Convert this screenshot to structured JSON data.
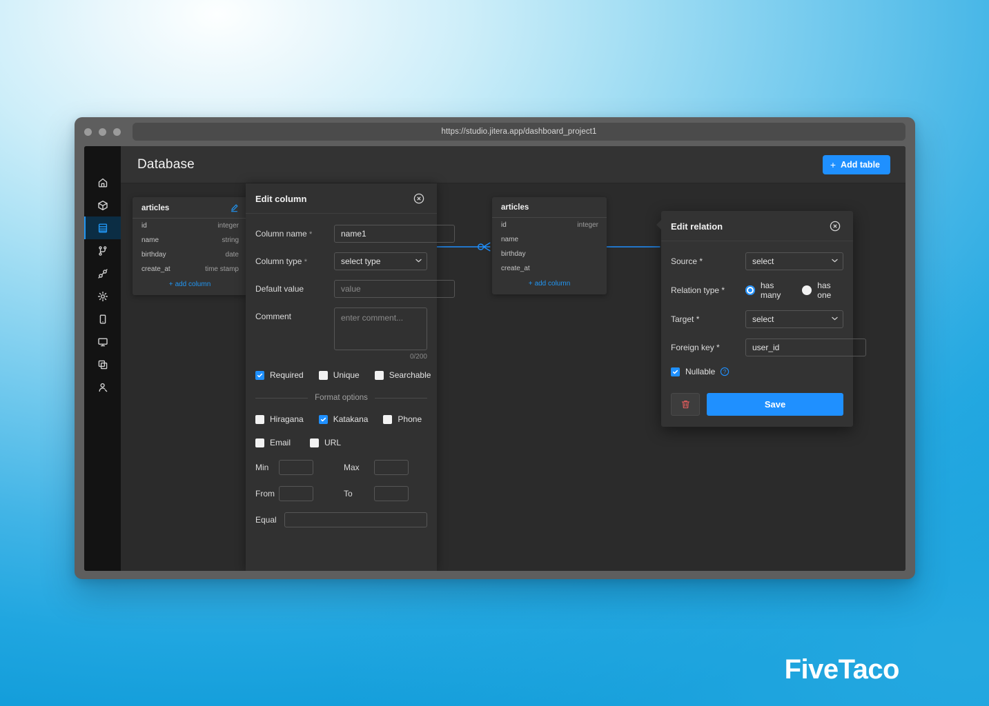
{
  "browser": {
    "url": "https://studio.jitera.app/dashboard_project1",
    "traffic_lights": [
      "close-dot",
      "minimize-dot",
      "maximize-dot"
    ]
  },
  "sidebar": {
    "items": [
      {
        "name": "home",
        "icon": "home-icon",
        "active": false
      },
      {
        "name": "package",
        "icon": "cube-icon",
        "active": false
      },
      {
        "name": "database",
        "icon": "database-icon",
        "active": true
      },
      {
        "name": "workflow",
        "icon": "branch-icon",
        "active": false
      },
      {
        "name": "plugins",
        "icon": "plug-icon",
        "active": false
      },
      {
        "name": "settings",
        "icon": "gear-icon",
        "active": false
      },
      {
        "name": "mobile",
        "icon": "mobile-icon",
        "active": false
      },
      {
        "name": "desktop",
        "icon": "monitor-icon",
        "active": false
      },
      {
        "name": "layers",
        "icon": "copy-icon",
        "active": false
      },
      {
        "name": "members",
        "icon": "user-search-icon",
        "active": false
      }
    ]
  },
  "header": {
    "title": "Database",
    "add_table_label": "Add table",
    "add_table_plus": "+"
  },
  "tables": [
    {
      "name": "articles",
      "edit_icon": "pencil-icon",
      "columns": [
        {
          "name": "id",
          "type": "integer"
        },
        {
          "name": "name",
          "type": "string"
        },
        {
          "name": "birthday",
          "type": "date"
        },
        {
          "name": "create_at",
          "type": "time stamp"
        }
      ],
      "add_column_label": "add column",
      "add_column_plus": "+"
    },
    {
      "name": "articles",
      "edit_icon": "pencil-icon",
      "columns": [
        {
          "name": "id",
          "type": "integer"
        },
        {
          "name": "name",
          "type": ""
        },
        {
          "name": "birthday",
          "type": ""
        },
        {
          "name": "create_at",
          "type": ""
        }
      ],
      "add_column_label": "add column",
      "add_column_plus": "+"
    }
  ],
  "edit_column": {
    "title": "Edit column",
    "close_icon": "close-circle-icon",
    "fields": {
      "column_name": {
        "label": "Column name",
        "required_mark": "*",
        "value": "name1"
      },
      "column_type": {
        "label": "Column type",
        "required_mark": "*",
        "value": "select type"
      },
      "default_value": {
        "label": "Default value",
        "placeholder": "value",
        "value": ""
      },
      "comment": {
        "label": "Comment",
        "placeholder": "enter comment...",
        "value": "",
        "counter": "0/200"
      }
    },
    "flags": [
      {
        "label": "Required",
        "checked": true
      },
      {
        "label": "Unique",
        "checked": false
      },
      {
        "label": "Searchable",
        "checked": false
      }
    ],
    "format_options_label": "Format options",
    "format_options": [
      {
        "label": "Hiragana",
        "checked": false
      },
      {
        "label": "Katakana",
        "checked": true
      },
      {
        "label": "Phone",
        "checked": false
      },
      {
        "label": "Email",
        "checked": false
      },
      {
        "label": "URL",
        "checked": false
      }
    ],
    "ranges": {
      "min_label": "Min",
      "min_value": "",
      "max_label": "Max",
      "max_value": "",
      "from_label": "From",
      "from_value": "",
      "to_label": "To",
      "to_value": "",
      "equal_label": "Equal",
      "equal_value": ""
    }
  },
  "edit_relation": {
    "title": "Edit relation",
    "close_icon": "close-circle-icon",
    "source": {
      "label": "Source",
      "required_mark": "*",
      "value": "select"
    },
    "relation_type": {
      "label": "Relation type",
      "required_mark": "*",
      "options": [
        {
          "label": "has many",
          "selected": true
        },
        {
          "label": "has one",
          "selected": false
        }
      ]
    },
    "target": {
      "label": "Target",
      "required_mark": "*",
      "value": "select"
    },
    "foreign_key": {
      "label": "Foreign key",
      "required_mark": "*",
      "value": "user_id"
    },
    "nullable": {
      "label": "Nullable",
      "checked": true,
      "help_icon": "help-circle-icon"
    },
    "delete_icon": "trash-icon",
    "save_label": "Save"
  },
  "watermark": {
    "text": "FiveTaco"
  },
  "colors": {
    "accent": "#1f90ff",
    "relation_line": "#1f90ff",
    "sidebar_active_bg": "#0b2d44",
    "panel_bg": "#313131",
    "card_bg": "#333333",
    "canvas_bg": "#2b2b2b",
    "danger": "#e05c5c",
    "bg_gradient_from": "#f6fdff",
    "bg_gradient_to": "#0e9ad8"
  }
}
